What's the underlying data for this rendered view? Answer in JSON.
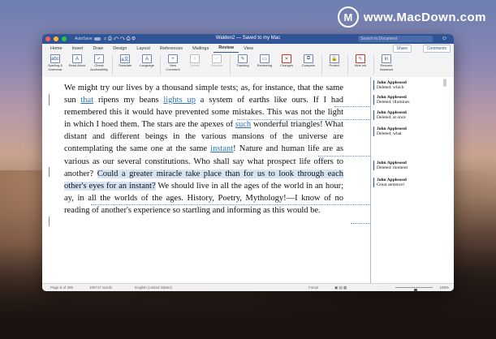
{
  "watermark": {
    "logo": "M",
    "text": "www.MacDown.com"
  },
  "titlebar": {
    "autosave": "AutoSave",
    "quick_access": "⌂ ⎙ ↶ ↷ ⎙ ⚙",
    "doc_title": "Walden2 — Saved to my Mac",
    "search_placeholder": "Search in Document",
    "account_icon": "☺"
  },
  "tabs": [
    "Home",
    "Insert",
    "Draw",
    "Design",
    "Layout",
    "References",
    "Mailings",
    "Review",
    "View"
  ],
  "active_tab": "Review",
  "share_label": "Share",
  "comments_label": "Comments",
  "ribbon": [
    {
      "icon": "abc",
      "label": "Spelling & Grammar",
      "dim": false,
      "red": false
    },
    {
      "icon": "A",
      "label": "Read Aloud",
      "dim": false,
      "red": false
    },
    {
      "icon": "✓",
      "label": "Check Accessibility",
      "dim": false,
      "red": false
    },
    {
      "icon": "a文",
      "label": "Translate",
      "dim": false,
      "red": false
    },
    {
      "icon": "A",
      "label": "Language",
      "dim": false,
      "red": false
    },
    {
      "icon": "+",
      "label": "New Comment",
      "dim": false,
      "red": false
    },
    {
      "icon": "×",
      "label": "Delete",
      "dim": true,
      "red": false
    },
    {
      "icon": "✓",
      "label": "Resolve",
      "dim": true,
      "red": false
    },
    {
      "icon": "✎",
      "label": "Tracking",
      "dim": false,
      "red": false
    },
    {
      "icon": "▭",
      "label": "Reviewing",
      "dim": false,
      "red": false
    },
    {
      "icon": "✕",
      "label": "Changes",
      "dim": false,
      "red": true
    },
    {
      "icon": "⧉",
      "label": "Compare",
      "dim": false,
      "red": false
    },
    {
      "icon": "🔒",
      "label": "Protect",
      "dim": false,
      "red": false
    },
    {
      "icon": "✎",
      "label": "Hide Ink",
      "dim": false,
      "red": true
    },
    {
      "icon": "in",
      "label": "Resume Assistant",
      "dim": false,
      "red": false
    }
  ],
  "document": {
    "seg1": "We might try our lives by a thousand simple tests; as, for instance, that the same sun ",
    "ins1": "that",
    "seg2": " ripens my beans ",
    "ins2": "lights up",
    "seg3": " a system of earths like ours. If I had remembered this it would have prevented some mistakes. This was not the light in which I hoed them. The stars are the apexes of ",
    "ins3": "such",
    "seg4": " wonderful triangles! What distant and different beings in the various mansions of the universe are contemplating the same one at the same ",
    "ins4": "instant",
    "seg5": "! Nature and human life are as various as our several constitutions. Who shall say what prospect life offers to another? ",
    "hl": "Could a greater miracle take place than for us to look through each other's eyes for an instant?",
    "seg6": " We should live in all the ages of the world in an hour; ay, in all the worlds of the ages. History, Poetry, Mythology!—I know of no reading of another's experience so startling and informing as this would be."
  },
  "comments": [
    {
      "author": "John Appleseed",
      "text": "Deleted: which"
    },
    {
      "author": "John Appleseed",
      "text": "Deleted: illumines"
    },
    {
      "author": "John Appleseed",
      "text": "Deleted: at once"
    },
    {
      "author": "John Appleseed",
      "text": "Deleted: what"
    },
    {
      "author": "John Appleseed",
      "text": "Deleted: moment"
    },
    {
      "author": "John Appleseed",
      "text": "Great sentence!"
    }
  ],
  "status": {
    "page": "Page 8 of 296",
    "words": "106717 words",
    "language": "English (United States)",
    "focus": "Focus",
    "zoom": "159%",
    "zoom_fraction": 0.55
  }
}
